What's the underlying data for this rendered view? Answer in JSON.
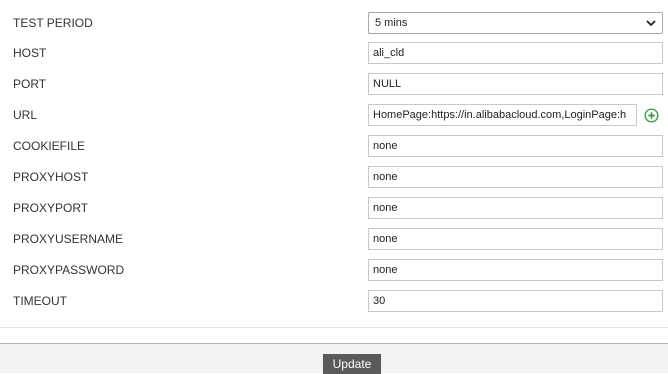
{
  "form": {
    "test_period": {
      "label": "TEST PERIOD",
      "value": "5 mins"
    },
    "host": {
      "label": "HOST",
      "value": "ali_cld"
    },
    "port": {
      "label": "PORT",
      "value": "NULL"
    },
    "url": {
      "label": "URL",
      "value": "HomePage:https://in.alibabacloud.com,LoginPage:h"
    },
    "cookiefile": {
      "label": "COOKIEFILE",
      "value": "none"
    },
    "proxyhost": {
      "label": "PROXYHOST",
      "value": "none"
    },
    "proxyport": {
      "label": "PROXYPORT",
      "value": "none"
    },
    "proxyusername": {
      "label": "PROXYUSERNAME",
      "value": "none"
    },
    "proxypassword": {
      "label": "PROXYPASSWORD",
      "value": "none"
    },
    "timeout": {
      "label": "TIMEOUT",
      "value": "30"
    }
  },
  "footer": {
    "update_label": "Update"
  },
  "icons": {
    "dropdown": "chevron-down-icon",
    "add": "plus-circle-icon"
  },
  "colors": {
    "add_icon": "#2e9e3e",
    "button_bg": "#5a5a5a",
    "footer_bg": "#f2f2f2"
  }
}
